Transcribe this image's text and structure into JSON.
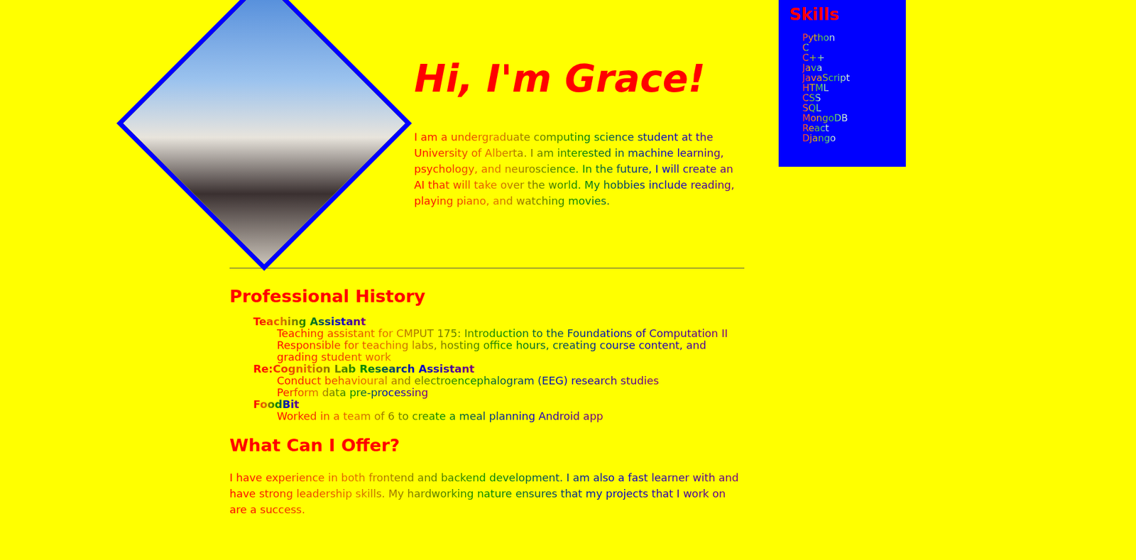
{
  "intro": {
    "heading": "Hi, I'm Grace!",
    "text": "I am a undergraduate computing science student at the University of Alberta. I am interested in machine learning, psychology, and neuroscience. In the future, I will create an AI that will take over the world. My hobbies include reading, playing piano, and watching movies."
  },
  "skills": {
    "title": "Skills",
    "items": [
      "Python",
      "C",
      "C++",
      "Java",
      "JavaScript",
      "HTML",
      "CSS",
      "SQL",
      "MongoDB",
      "React",
      "Django"
    ]
  },
  "history": {
    "title": "Professional History",
    "entries": [
      {
        "title": "Teaching Assistant",
        "details": [
          "Teaching assistant for CMPUT 175: Introduction to the Foundations of Computation II",
          "Responsible for teaching labs, hosting office hours, creating course content, and grading student work"
        ]
      },
      {
        "title": "Re:Cognition Lab Research Assistant",
        "details": [
          "Conduct behavioural and electroencephalogram (EEG) research studies",
          "Perform data pre-processing"
        ]
      },
      {
        "title": "FoodBit",
        "details": [
          "Worked in a team of 6 to create a meal planning Android app"
        ]
      }
    ]
  },
  "offer": {
    "title": "What Can I Offer?",
    "text": "I have experience in both frontend and backend development. I am also a fast learner with and have strong leadership skills. My hardworking nature ensures that my projects that I work on are a success."
  }
}
